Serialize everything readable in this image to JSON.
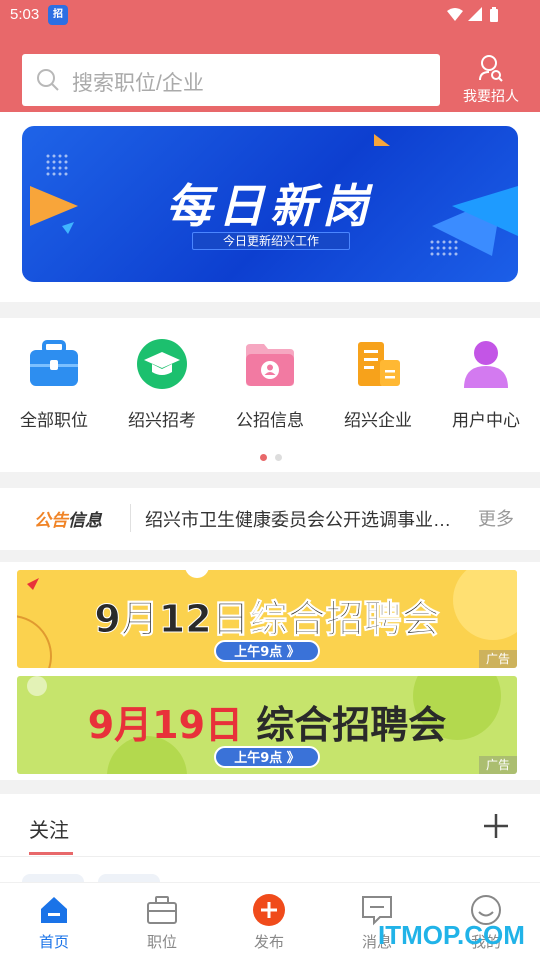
{
  "status_bar": {
    "time": "5:03",
    "app_badge": "招"
  },
  "header": {
    "search_placeholder": "搜索职位/企业",
    "recruit_label": "我要招人"
  },
  "banner": {
    "headline": "每日新岗",
    "subline": "今日更新绍兴工作"
  },
  "menu": {
    "items": [
      {
        "label": "全部职位",
        "icon": "briefcase-icon",
        "color": "#2d8ef0"
      },
      {
        "label": "绍兴招考",
        "icon": "graduation-cap-icon",
        "color": "#1cc06e"
      },
      {
        "label": "公招信息",
        "icon": "folder-user-icon",
        "color": "#f27aa2"
      },
      {
        "label": "绍兴企业",
        "icon": "building-icon",
        "color": "#f7a21b"
      },
      {
        "label": "用户中心",
        "icon": "user-icon",
        "color": "#c355e6"
      }
    ],
    "page_indicator": {
      "pages": 2,
      "active": 1
    }
  },
  "notice": {
    "tag_a": "公告",
    "tag_b": "信息",
    "text": "绍兴市卫生健康委员会公开选调事业单位工作人员",
    "more": "更多"
  },
  "ads": [
    {
      "title_date": "9月12日",
      "title_rest": "综合招聘会",
      "time": "上午9点 》",
      "tag": "广告"
    },
    {
      "title_date": "9月19日",
      "title_rest": " 综合招聘会",
      "time": "上午9点 》",
      "tag": "广告"
    }
  ],
  "follow": {
    "title": "关注"
  },
  "tabbar": {
    "tabs": [
      {
        "label": "首页",
        "icon": "home-icon",
        "active": true
      },
      {
        "label": "职位",
        "icon": "briefcase-icon",
        "active": false
      },
      {
        "label": "发布",
        "icon": "plus-circle-icon",
        "active": false
      },
      {
        "label": "消息",
        "icon": "message-icon",
        "active": false
      },
      {
        "label": "我的",
        "icon": "smile-icon",
        "active": false
      }
    ]
  },
  "watermark": "ITMOP.COM",
  "colors": {
    "brand": "#e8686a",
    "accent": "#1a73e8",
    "publish": "#f04b1b"
  }
}
